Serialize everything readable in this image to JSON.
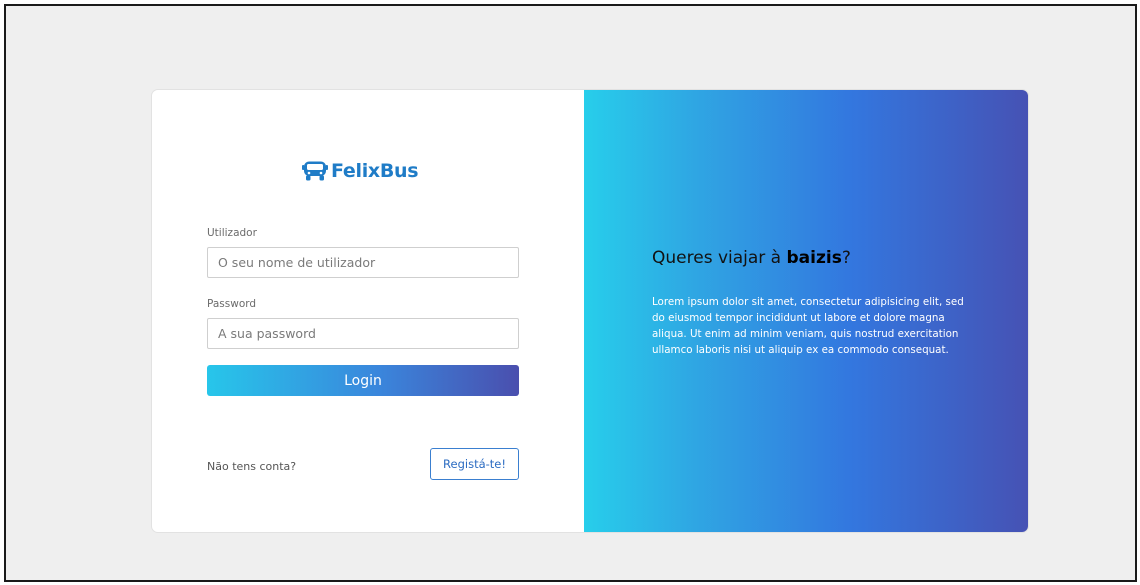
{
  "brand": {
    "name": "FelixBus",
    "icon": "bus-icon",
    "color": "#1f7cc7"
  },
  "login_form": {
    "username_label": "Utilizador",
    "username_placeholder": "O seu nome de utilizador",
    "username_value": "",
    "password_label": "Password",
    "password_placeholder": "A sua password",
    "password_value": "",
    "login_button": "Login"
  },
  "register": {
    "prompt": "Não tens conta?",
    "button": "Registá-te!"
  },
  "promo": {
    "headline_prefix": "Queres viajar à ",
    "headline_bold": "baizis",
    "headline_suffix": "?",
    "body": "Lorem ipsum dolor sit amet, consectetur adipisicing elit, sed do eiusmod tempor incididunt ut labore et dolore magna aliqua. Ut enim ad minim veniam, quis nostrud exercitation ullamco laboris nisi ut aliquip ex ea commodo consequat."
  },
  "colors": {
    "gradient_start": "#27ceeb",
    "gradient_end": "#4652b4",
    "page_background": "#efefef"
  }
}
